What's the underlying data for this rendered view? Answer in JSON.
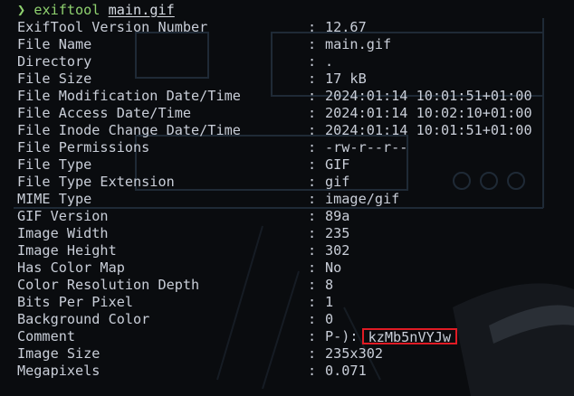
{
  "terminal": {
    "prompt_symbol": "❯",
    "command": "exiftool",
    "argument": "main.gif"
  },
  "output": [
    {
      "key": "ExifTool Version Number",
      "value": "12.67"
    },
    {
      "key": "File Name",
      "value": "main.gif"
    },
    {
      "key": "Directory",
      "value": "."
    },
    {
      "key": "File Size",
      "value": "17 kB"
    },
    {
      "key": "File Modification Date/Time",
      "value": "2024:01:14 10:01:51+01:00"
    },
    {
      "key": "File Access Date/Time",
      "value": "2024:01:14 10:02:10+01:00"
    },
    {
      "key": "File Inode Change Date/Time",
      "value": "2024:01:14 10:01:51+01:00"
    },
    {
      "key": "File Permissions",
      "value": "-rw-r--r--"
    },
    {
      "key": "File Type",
      "value": "GIF"
    },
    {
      "key": "File Type Extension",
      "value": "gif"
    },
    {
      "key": "MIME Type",
      "value": "image/gif"
    },
    {
      "key": "GIF Version",
      "value": "89a"
    },
    {
      "key": "Image Width",
      "value": "235"
    },
    {
      "key": "Image Height",
      "value": "302"
    },
    {
      "key": "Has Color Map",
      "value": "No"
    },
    {
      "key": "Color Resolution Depth",
      "value": "8"
    },
    {
      "key": "Bits Per Pixel",
      "value": "1"
    },
    {
      "key": "Background Color",
      "value": "0"
    },
    {
      "key": "Comment",
      "value": "P-):",
      "highlight": "kzMb5nVYJw"
    },
    {
      "key": "Image Size",
      "value": "235x302"
    },
    {
      "key": "Megapixels",
      "value": "0.071"
    }
  ],
  "separator": ":",
  "colors": {
    "background": "#0a0c0f",
    "text": "#c9ced8",
    "prompt": "#8fd16f",
    "highlight_border": "#e01b24"
  }
}
